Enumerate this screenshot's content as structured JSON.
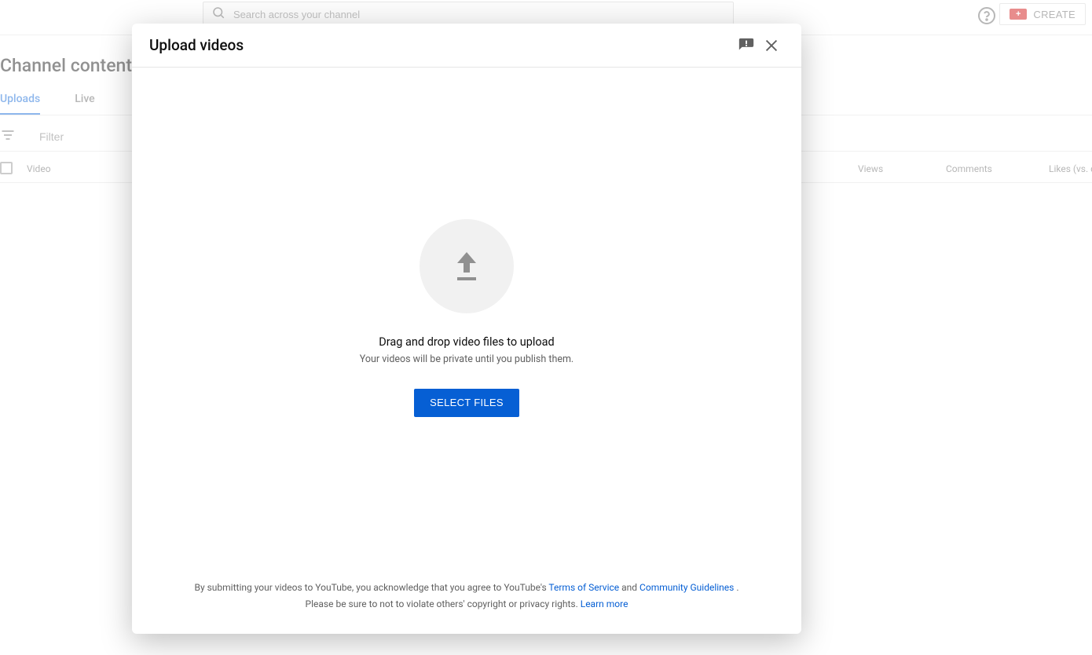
{
  "header": {
    "search_placeholder": "Search across your channel",
    "create_label": "CREATE"
  },
  "page": {
    "title": "Channel content",
    "tabs": {
      "uploads": "Uploads",
      "live": "Live"
    },
    "filter_placeholder": "Filter",
    "columns": {
      "video": "Video",
      "views": "Views",
      "comments": "Comments",
      "likes": "Likes (vs. d"
    }
  },
  "modal": {
    "title": "Upload videos",
    "drag_title": "Drag and drop video files to upload",
    "drag_sub": "Your videos will be private until you publish them.",
    "select_button": "SELECT FILES",
    "footer": {
      "line1_pre": "By submitting your videos to YouTube, you acknowledge that you agree to YouTube's ",
      "tos": "Terms of Service",
      "and": " and ",
      "guidelines": "Community Guidelines",
      "period": ".",
      "line2_pre": "Please be sure to not to violate others' copyright or privacy rights. ",
      "learn": "Learn more"
    }
  }
}
